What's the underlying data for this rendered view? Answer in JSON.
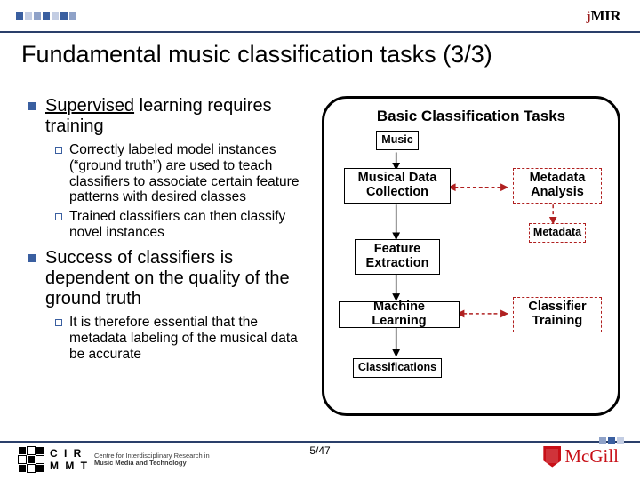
{
  "logos": {
    "jmir_j": "j",
    "jmir_mir": "MIR",
    "cirmmt_acronym": "C I R\nM M T",
    "cirmmt_line1": "Centre for Interdisciplinary Research in",
    "cirmmt_line2": "Music Media and Technology",
    "mcgill": "McGill"
  },
  "title": "Fundamental music classification tasks (3/3)",
  "bullets": {
    "b1": {
      "underlined": "Supervised",
      "rest": " learning requires training"
    },
    "b1a": "Correctly labeled model instances (“ground truth”) are used to teach classifiers to associate certain feature patterns with desired classes",
    "b1b": "Trained classifiers can then classify novel instances",
    "b2": "Success of classifiers is dependent on the quality of the ground truth",
    "b2a": "It is therefore essential that the metadata labeling of the musical data be accurate"
  },
  "diagram": {
    "title": "Basic Classification Tasks",
    "music": "Music",
    "mdc": "Musical Data\nCollection",
    "ma": "Metadata\nAnalysis",
    "metadata": "Metadata",
    "fe": "Feature\nExtraction",
    "ml": "Machine Learning",
    "ct": "Classifier\nTraining",
    "class": "Classifications"
  },
  "page": "5/47"
}
